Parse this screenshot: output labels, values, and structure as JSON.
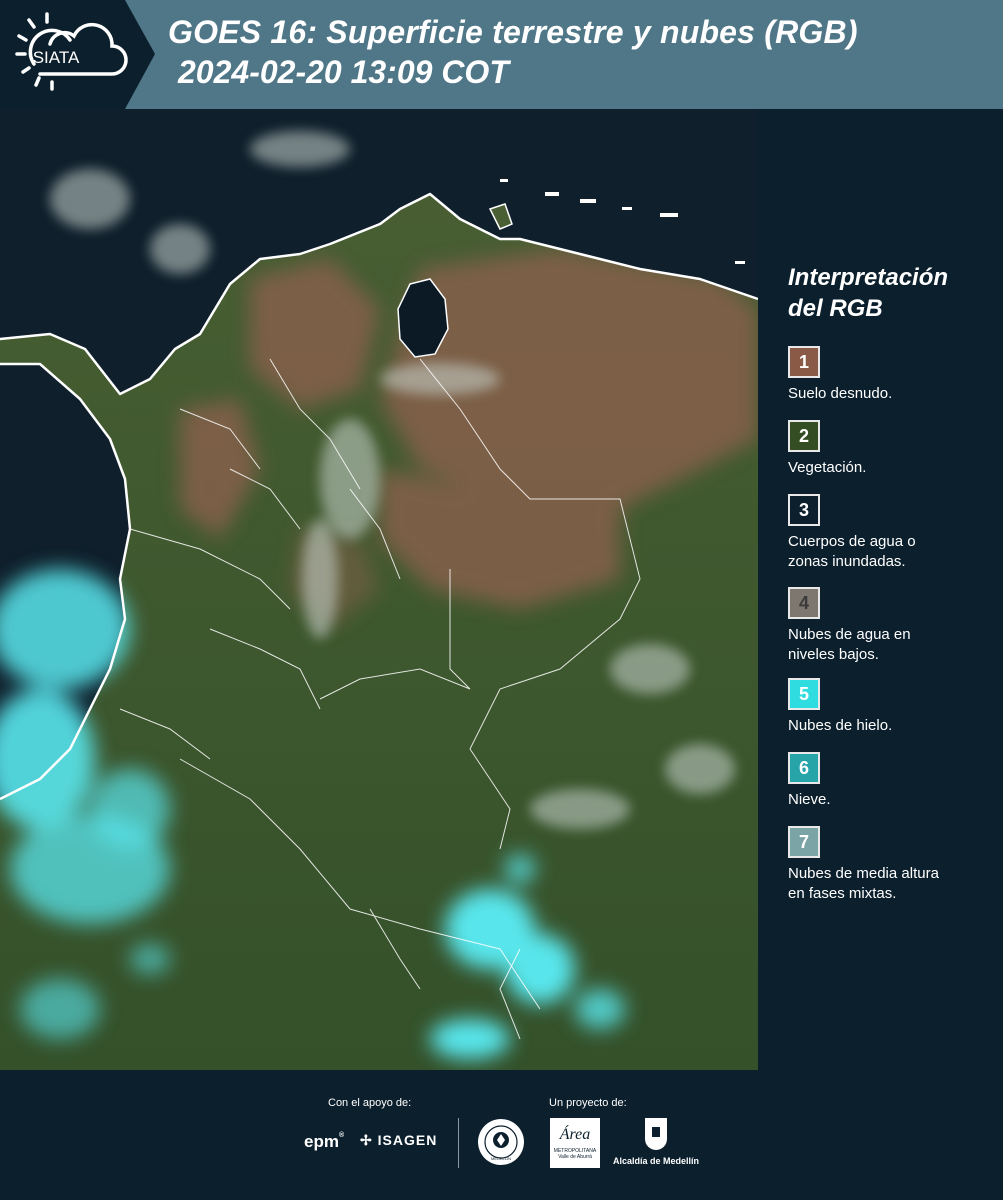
{
  "header": {
    "logo_text": "SIATA",
    "title_line1": "GOES 16: Superficie terrestre y nubes (RGB)",
    "title_line2": "2024-02-20 13:09 COT"
  },
  "legend": {
    "title_line1": "Interpretación",
    "title_line2": "del RGB",
    "items": [
      {
        "number": "1",
        "label_line1": "Suelo desnudo.",
        "label_line2": "",
        "color": "#8a5a47"
      },
      {
        "number": "2",
        "label_line1": "Vegetación.",
        "label_line2": "",
        "color": "#354d23"
      },
      {
        "number": "3",
        "label_line1": "Cuerpos de agua o",
        "label_line2": "zonas inundadas.",
        "color": "#0c1f2c"
      },
      {
        "number": "4",
        "label_line1": "Nubes de agua en",
        "label_line2": "niveles bajos.",
        "color": "#7d7770"
      },
      {
        "number": "5",
        "label_line1": "Nubes de hielo.",
        "label_line2": "",
        "color": "#2fdce0"
      },
      {
        "number": "6",
        "label_line1": "Nieve.",
        "label_line2": "",
        "color": "#27a4a8"
      },
      {
        "number": "7",
        "label_line1": "Nubes de media altura",
        "label_line2": "en fases mixtas.",
        "color": "#7aa4a6"
      }
    ]
  },
  "footer": {
    "support_label": "Con el apoyo de:",
    "project_label": "Un proyecto de:",
    "sponsor_epm": "epm",
    "sponsor_isagen": "ISAGEN",
    "partner_area_line1": "Área",
    "partner_area_line2": "METROPOLITANA",
    "partner_area_line3": "Valle de Aburrá",
    "partner_alcaldia": "Alcaldía de Medellín",
    "seal_text": "MEDELLÍN"
  },
  "colors": {
    "header_bg": "#4f7787",
    "dark_bg": "#0c1f2c",
    "vegetation": "#3d5a2a",
    "bare_soil": "#8a5a47",
    "ice_clouds": "#59e6ec"
  }
}
